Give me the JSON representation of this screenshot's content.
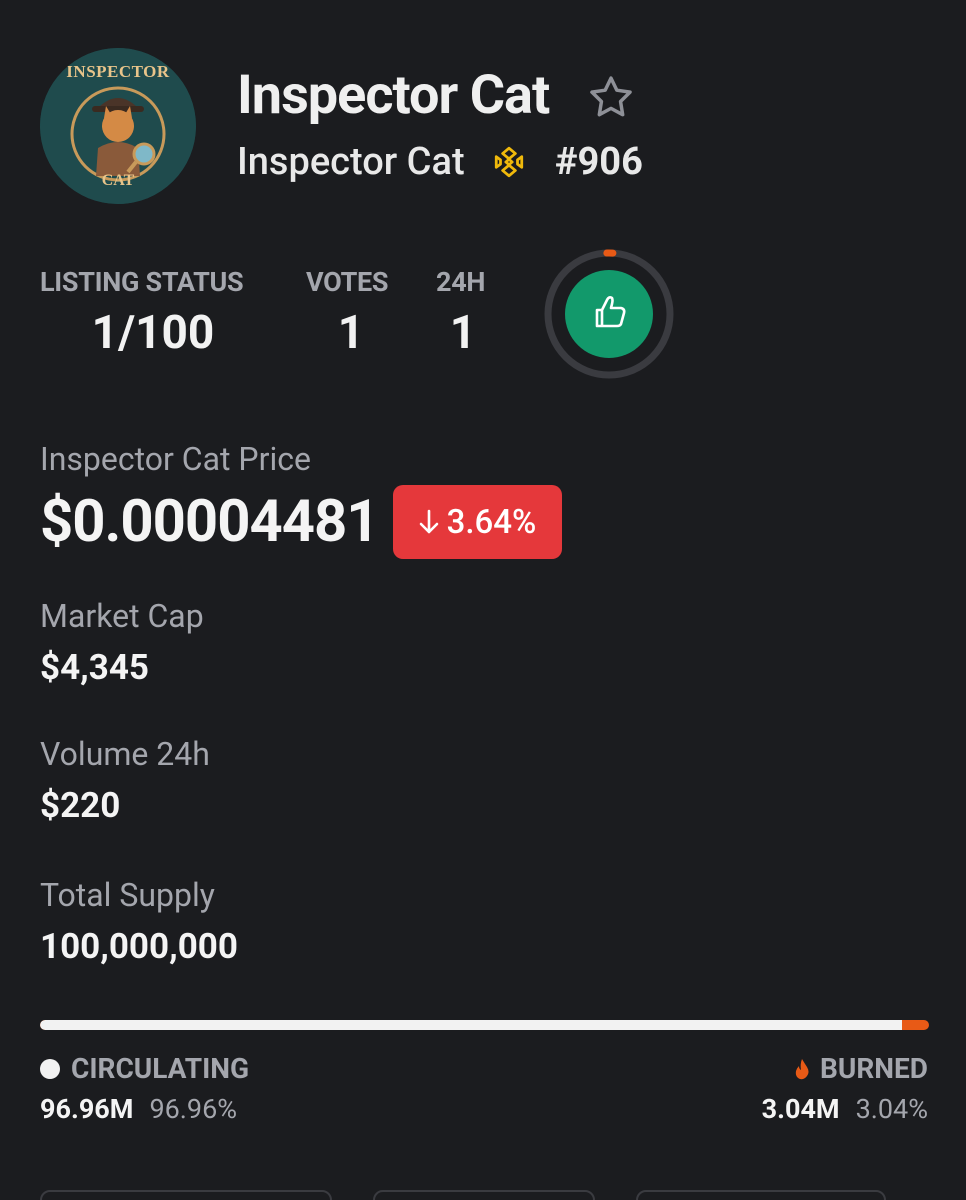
{
  "header": {
    "coin_name": "Inspector Cat",
    "sub_name": "Inspector Cat",
    "rank": "#906",
    "logo_text_top": "INSPECTOR",
    "logo_text_bottom": "CAT",
    "chain_icon": "bnb-chain-icon",
    "favorite_icon": "star-outline-icon"
  },
  "stats": {
    "listing_status_label": "LISTING STATUS",
    "listing_status_value": "1/100",
    "votes_label": "VOTES",
    "votes_value": "1",
    "h24_label": "24H",
    "h24_value": "1",
    "vote_button_icon": "thumbs-up-icon",
    "vote_progress_fraction": 0.01
  },
  "price": {
    "label": "Inspector Cat Price",
    "value": "$0.00004481",
    "change": "3.64%",
    "change_direction": "down"
  },
  "market_cap": {
    "label": "Market Cap",
    "value": "$4,345"
  },
  "volume": {
    "label": "Volume 24h",
    "value": "$220"
  },
  "supply": {
    "label": "Total Supply",
    "value": "100,000,000",
    "circulating_fraction": 0.9696,
    "circulating_label": "CIRCULATING",
    "circulating_amount": "96.96M",
    "circulating_pct": "96.96%",
    "burned_label": "BURNED",
    "burned_amount": "3.04M",
    "burned_pct": "3.04%"
  },
  "colors": {
    "background": "#1b1c1f",
    "accent_green": "#12996b",
    "negative_red": "#e5383b",
    "burn_orange": "#e85a16",
    "muted_text": "#a4a6ad"
  }
}
